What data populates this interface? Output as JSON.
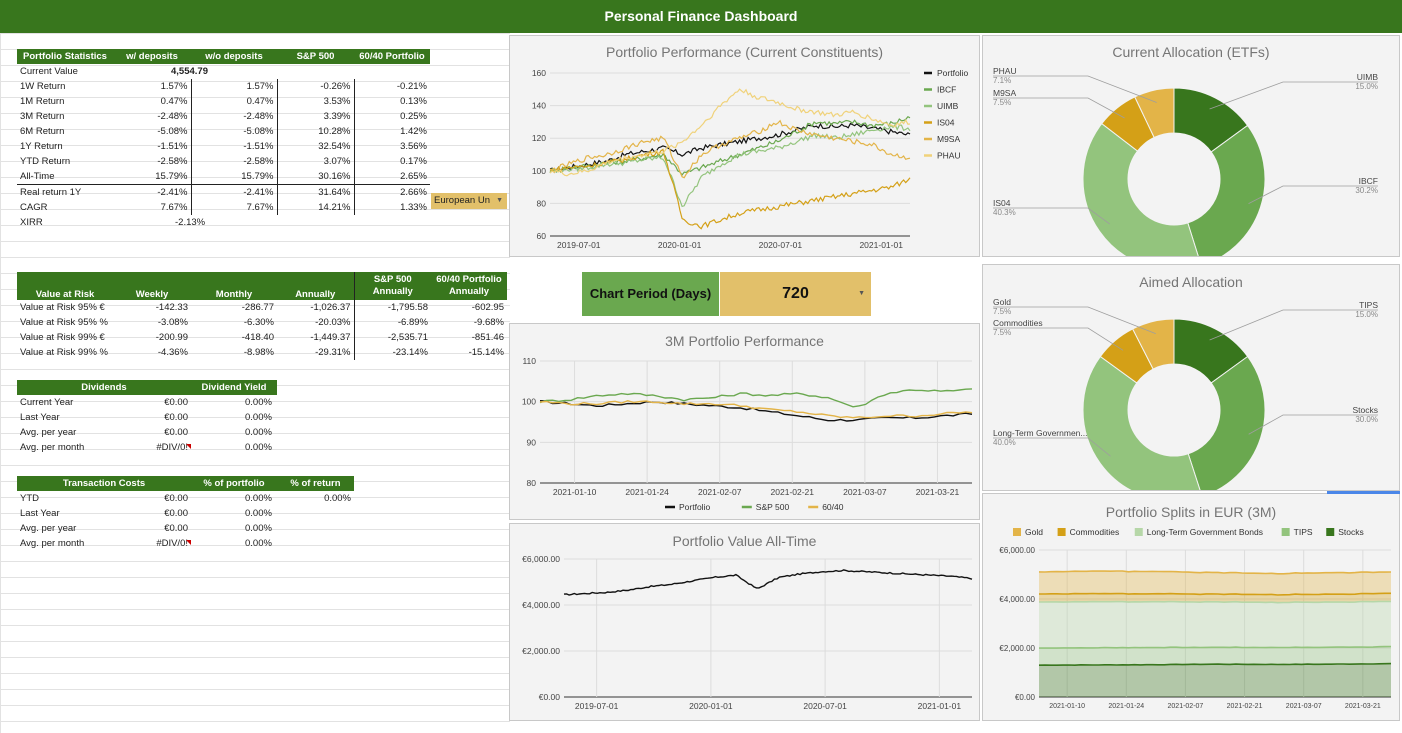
{
  "app": {
    "title": "Personal Finance Dashboard"
  },
  "portfolio_stats": {
    "headers": [
      "Portfolio Statistics",
      "w/ deposits",
      "w/o deposits",
      "S&P 500",
      "60/40 Portfolio"
    ],
    "current_value": {
      "label": "Current Value",
      "value": "4,554.79"
    },
    "rows": [
      [
        "1W Return",
        "1.57%",
        "1.57%",
        "-0.26%",
        "-0.21%"
      ],
      [
        "1M Return",
        "0.47%",
        "0.47%",
        "3.53%",
        "0.13%"
      ],
      [
        "3M Return",
        "-2.48%",
        "-2.48%",
        "3.39%",
        "0.25%"
      ],
      [
        "6M Return",
        "-5.08%",
        "-5.08%",
        "10.28%",
        "1.42%"
      ],
      [
        "1Y Return",
        "-1.51%",
        "-1.51%",
        "32.54%",
        "3.56%"
      ],
      [
        "YTD Return",
        "-2.58%",
        "-2.58%",
        "3.07%",
        "0.17%"
      ],
      [
        "All-Time",
        "15.79%",
        "15.79%",
        "30.16%",
        "2.65%"
      ],
      [
        "Real return 1Y",
        "-2.41%",
        "-2.41%",
        "31.64%",
        "2.66%"
      ],
      [
        "CAGR",
        "7.67%",
        "7.67%",
        "14.21%",
        "1.33%"
      ]
    ],
    "xirr": {
      "label": "XIRR",
      "value": "-2.13%"
    },
    "inflation_select": "European Un"
  },
  "var_table": {
    "headers": [
      "Value at Risk",
      "Weekly",
      "Monthly",
      "Annually",
      "S&P 500 Annually",
      "60/40 Portfolio Annually"
    ],
    "rows": [
      [
        "Value at Risk 95% €",
        "-142.33",
        "-286.77",
        "-1,026.37",
        "-1,795.58",
        "-602.95"
      ],
      [
        "Value at Risk 95% %",
        "-3.08%",
        "-6.30%",
        "-20.03%",
        "-6.89%",
        "-9.68%"
      ],
      [
        "Value at Risk 99% €",
        "-200.99",
        "-418.40",
        "-1,449.37",
        "-2,535.71",
        "-851.46"
      ],
      [
        "Value at Risk 99% %",
        "-4.36%",
        "-8.98%",
        "-29.31%",
        "-23.14%",
        "-15.14%"
      ]
    ]
  },
  "dividends": {
    "headers": [
      "Dividends",
      "Dividend Yield"
    ],
    "rows": [
      [
        "Current Year",
        "€0.00",
        "0.00%"
      ],
      [
        "Last Year",
        "€0.00",
        "0.00%"
      ],
      [
        "Avg. per year",
        "€0.00",
        "0.00%"
      ],
      [
        "Avg. per month",
        "#DIV/0!",
        "0.00%"
      ]
    ]
  },
  "transactions": {
    "headers": [
      "Transaction Costs",
      "% of portfolio",
      "% of return"
    ],
    "rows": [
      [
        "YTD",
        "€0.00",
        "0.00%",
        "0.00%"
      ],
      [
        "Last Year",
        "€0.00",
        "0.00%",
        ""
      ],
      [
        "Avg. per year",
        "€0.00",
        "0.00%",
        ""
      ],
      [
        "Avg. per month",
        "#DIV/0!",
        "0.00%",
        ""
      ]
    ]
  },
  "chart_period": {
    "label": "Chart Period (Days)",
    "value": "720"
  },
  "colors": {
    "dark_green": "#38761d",
    "mid_green": "#6aa84f",
    "light_green": "#93c47d",
    "dark_gold": "#d4a017",
    "gold": "#e3b448",
    "light_gold": "#f0d27a",
    "black": "#111111"
  },
  "chart_data": [
    {
      "id": "performance",
      "type": "line",
      "title": "Portfolio Performance (Current Constituents)",
      "x_ticks": [
        "2019-07-01",
        "2020-01-01",
        "2020-07-01",
        "2021-01-01"
      ],
      "y_ticks": [
        "60",
        "80",
        "100",
        "120",
        "140",
        "160"
      ],
      "ylim": [
        60,
        160
      ],
      "series": [
        {
          "name": "Portfolio",
          "color": "#111111",
          "values": [
            100,
            102,
            104,
            106,
            110,
            112,
            114,
            110,
            114,
            116,
            118,
            120,
            122,
            125,
            128,
            127,
            128,
            126,
            124,
            122
          ]
        },
        {
          "name": "IBCF",
          "color": "#6aa84f",
          "values": [
            100,
            102,
            103,
            105,
            106,
            108,
            110,
            98,
            102,
            106,
            110,
            114,
            118,
            124,
            130,
            129,
            130,
            128,
            129,
            133
          ]
        },
        {
          "name": "UIMB",
          "color": "#93c47d",
          "values": [
            100,
            101,
            102,
            104,
            105,
            107,
            108,
            78,
            96,
            104,
            110,
            112,
            114,
            118,
            122,
            120,
            122,
            125,
            127,
            126
          ]
        },
        {
          "name": "IS04",
          "color": "#d4a017",
          "values": [
            100,
            102,
            103,
            105,
            107,
            110,
            112,
            70,
            66,
            70,
            74,
            76,
            78,
            80,
            82,
            84,
            86,
            88,
            90,
            95
          ]
        },
        {
          "name": "M9SA",
          "color": "#e3b448",
          "values": [
            100,
            104,
            108,
            110,
            114,
            118,
            120,
            96,
            110,
            116,
            120,
            124,
            130,
            125,
            122,
            120,
            118,
            116,
            110,
            108
          ]
        },
        {
          "name": "PHAU",
          "color": "#f0d27a",
          "values": [
            100,
            98,
            100,
            105,
            108,
            110,
            112,
            118,
            128,
            140,
            150,
            145,
            142,
            138,
            136,
            134,
            136,
            132,
            128,
            130
          ]
        }
      ]
    },
    {
      "id": "current_allocation",
      "type": "pie",
      "title": "Current Allocation (ETFs)",
      "labels": [
        "UIMB",
        "IBCF",
        "IS04",
        "M9SA",
        "PHAU"
      ],
      "values": [
        15.0,
        30.2,
        40.3,
        7.5,
        7.1
      ],
      "value_labels": [
        "15.0%",
        "30.2%",
        "40.3%",
        "7.5%",
        "7.1%"
      ],
      "colors": [
        "#38761d",
        "#6aa84f",
        "#93c47d",
        "#d4a017",
        "#e3b448"
      ]
    },
    {
      "id": "aimed_allocation",
      "type": "pie",
      "title": "Aimed Allocation",
      "labels": [
        "TIPS",
        "Stocks",
        "Long-Term Governmen...",
        "Commodities",
        "Gold"
      ],
      "values": [
        15.0,
        30.0,
        40.0,
        7.5,
        7.5
      ],
      "value_labels": [
        "15.0%",
        "30.0%",
        "40.0%",
        "7.5%",
        "7.5%"
      ],
      "colors": [
        "#38761d",
        "#6aa84f",
        "#93c47d",
        "#d4a017",
        "#e3b448"
      ]
    },
    {
      "id": "perf_3m",
      "type": "line",
      "title": "3M Portfolio Performance",
      "x_ticks": [
        "2021-01-10",
        "2021-01-24",
        "2021-02-07",
        "2021-02-21",
        "2021-03-07",
        "2021-03-21"
      ],
      "y_ticks": [
        "80",
        "90",
        "100",
        "110"
      ],
      "ylim": [
        80,
        110
      ],
      "series": [
        {
          "name": "Portfolio",
          "color": "#111111",
          "values": [
            100,
            99.5,
            99,
            99.5,
            100,
            99.5,
            99,
            98.5,
            97.5,
            96.5,
            95.5,
            95.5,
            96,
            96,
            96.5,
            97
          ]
        },
        {
          "name": "S&P 500",
          "color": "#6aa84f",
          "values": [
            100,
            100.5,
            101.5,
            102,
            101.5,
            100.5,
            101,
            102,
            101.5,
            102,
            101,
            98.5,
            102,
            103,
            102.5,
            103
          ]
        },
        {
          "name": "60/40",
          "color": "#e3b448",
          "values": [
            100,
            99.5,
            99.5,
            100,
            100,
            99.5,
            99.5,
            99,
            98,
            97.5,
            96.5,
            96,
            96.5,
            96.5,
            97,
            97.5
          ]
        }
      ]
    },
    {
      "id": "value_all_time",
      "type": "line",
      "title": "Portfolio Value All-Time",
      "x_ticks": [
        "2019-07-01",
        "2020-01-01",
        "2020-07-01",
        "2021-01-01"
      ],
      "y_ticks": [
        "€0.00",
        "€2,000.00",
        "€4,000.00",
        "€6,000.00"
      ],
      "ylim": [
        0,
        6000
      ],
      "series": [
        {
          "name": "Portfolio",
          "color": "#111111",
          "values": [
            4450,
            4500,
            4550,
            4650,
            4800,
            4900,
            5050,
            5200,
            5300,
            4700,
            5200,
            5350,
            5450,
            5500,
            5450,
            5400,
            5350,
            5300,
            5250,
            5150
          ]
        }
      ]
    },
    {
      "id": "splits_3m",
      "type": "area",
      "title": "Portfolio Splits in EUR (3M)",
      "x_ticks": [
        "2021-01-10",
        "2021-01-24",
        "2021-02-07",
        "2021-02-21",
        "2021-03-07",
        "2021-03-21"
      ],
      "y_ticks": [
        "€0.00",
        "€2,000.00",
        "€4,000.00",
        "€6,000.00"
      ],
      "ylim": [
        0,
        6000
      ],
      "stacked": true,
      "series": [
        {
          "name": "Gold",
          "color": "#e3b448",
          "values": [
            900,
            920,
            910,
            880,
            860,
            880,
            870
          ]
        },
        {
          "name": "Commodities",
          "color": "#d4a017",
          "values": [
            330,
            330,
            325,
            320,
            315,
            320,
            330
          ]
        },
        {
          "name": "Long-Term Government Bonds",
          "color": "#b6d7a8",
          "values": [
            1880,
            1880,
            1870,
            1850,
            1840,
            1845,
            1850
          ]
        },
        {
          "name": "TIPS",
          "color": "#93c47d",
          "values": [
            700,
            700,
            700,
            690,
            690,
            690,
            695
          ]
        },
        {
          "name": "Stocks",
          "color": "#38761d",
          "values": [
            1300,
            1310,
            1320,
            1340,
            1330,
            1340,
            1360
          ]
        }
      ]
    }
  ]
}
